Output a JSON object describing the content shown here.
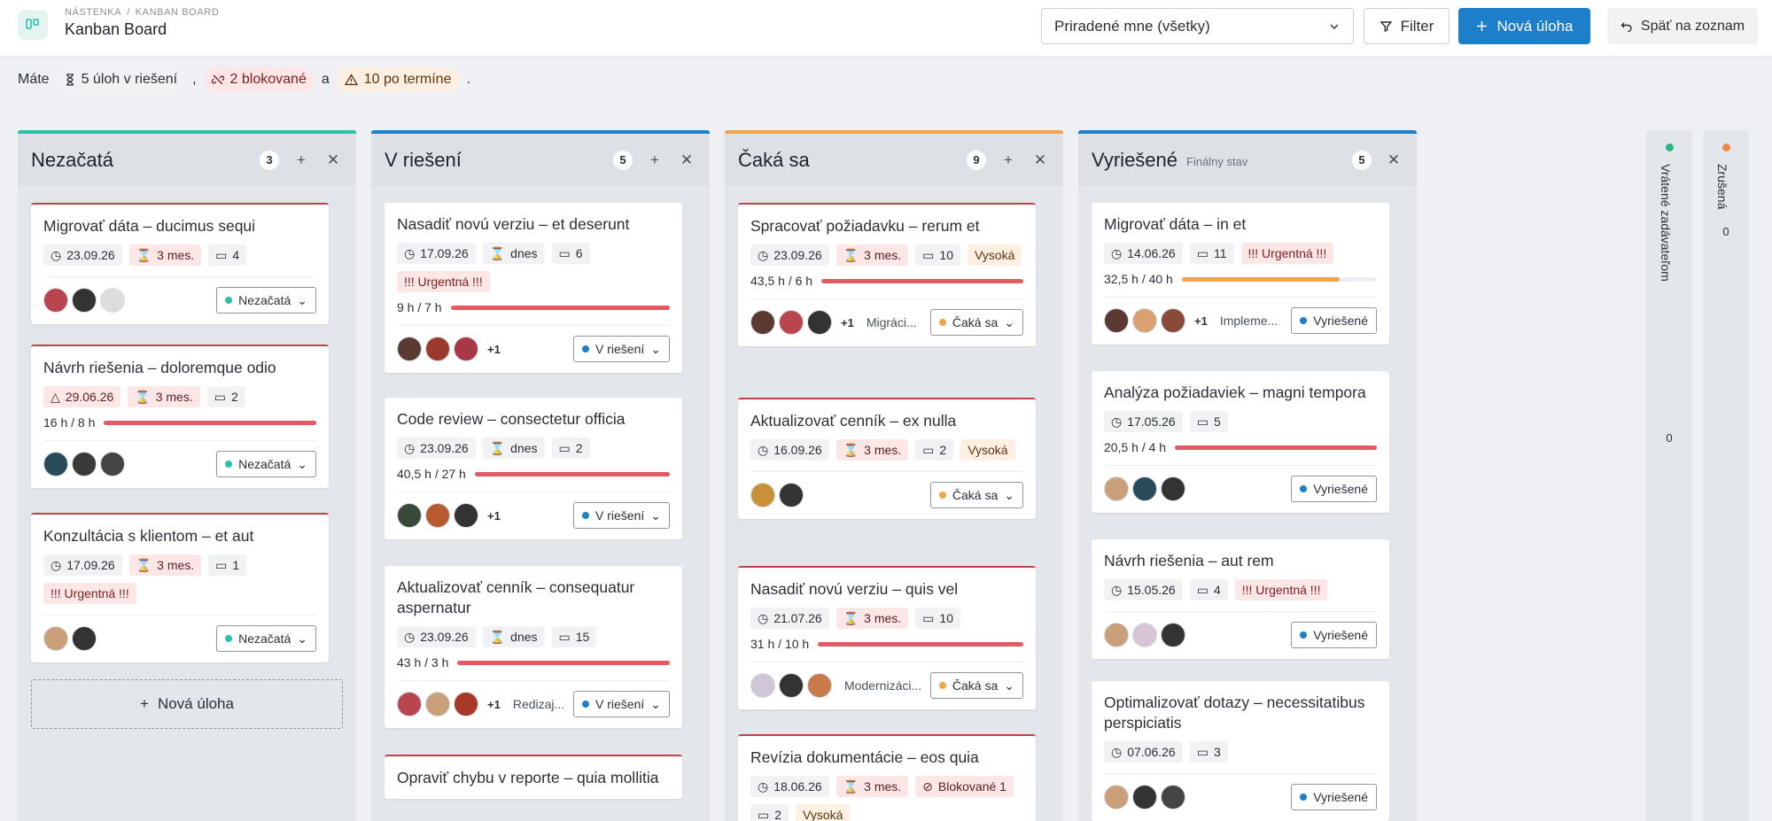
{
  "header": {
    "breadcrumb": [
      "NÁSTENKA",
      "KANBAN BOARD"
    ],
    "title": "Kanban Board",
    "assign_select": "Priradené mne (všetky)",
    "filter_label": "Filter",
    "new_task_label": "Nová úloha",
    "back_label": "Späť na zoznam"
  },
  "summary": {
    "prefix": "Máte",
    "in_progress": "5 úloh v riešení",
    "comma": ",",
    "blocked": "2 blokované",
    "and": "a",
    "overdue": "10 po termíne",
    "end": "."
  },
  "colors": {
    "teal": "#2bbfae",
    "blue": "#1d7ec9",
    "orange": "#f0a54a",
    "red_bar": "#e35a64",
    "green": "#2cb67d",
    "coral": "#f0844a"
  },
  "columns": [
    {
      "title": "Nezačatá",
      "subtitle": "",
      "count": "3",
      "cards": [
        {
          "title": "Migrovať dáta – ducimus sequi",
          "date": "23.09.26",
          "duration": "3 mes.",
          "comments": "4",
          "status": "Nezačatá"
        },
        {
          "title": "Návrh riešenia – doloremque odio",
          "date": "29.06.26",
          "duration": "3 mes.",
          "comments": "2",
          "progress_text": "16 h / 8 h",
          "progress": 1.0,
          "status": "Nezačatá"
        },
        {
          "title": "Konzultácia s klientom – et aut",
          "date": "17.09.26",
          "duration": "3 mes.",
          "comments": "1",
          "priority": "!!! Urgentná !!!",
          "status": "Nezačatá"
        }
      ],
      "new_task_label": "Nová úloha"
    },
    {
      "title": "V riešení",
      "subtitle": "",
      "count": "5",
      "cards": [
        {
          "title": "Nasadiť novú verziu – et deserunt",
          "date": "17.09.26",
          "duration": "dnes",
          "comments": "6",
          "priority": "!!! Urgentná !!!",
          "progress_text": "9 h / 7 h",
          "progress": 1.0,
          "more": "+1",
          "status": "V riešení"
        },
        {
          "title": "Code review – consectetur officia",
          "date": "23.09.26",
          "duration": "dnes",
          "comments": "2",
          "progress_text": "40,5 h / 27 h",
          "progress": 1.0,
          "more": "+1",
          "status": "V riešení"
        },
        {
          "title": "Aktualizovať cenník – consequatur aspernatur",
          "date": "23.09.26",
          "duration": "dnes",
          "comments": "15",
          "progress_text": "43 h / 3 h",
          "progress": 1.0,
          "more": "+1",
          "project": "Redizaj...",
          "status": "V riešení"
        },
        {
          "title": "Opraviť chybu v reporte – quia mollitia"
        }
      ]
    },
    {
      "title": "Čaká sa",
      "subtitle": "",
      "count": "9",
      "cards": [
        {
          "title": "Spracovať požiadavku – rerum et",
          "date": "23.09.26",
          "duration": "3 mes.",
          "comments": "10",
          "priority": "Vysoká",
          "progress_text": "43,5 h / 6 h",
          "progress": 1.0,
          "more": "+1",
          "project": "Migráci...",
          "status": "Čaká sa"
        },
        {
          "title": "Aktualizovať cenník – ex nulla",
          "date": "16.09.26",
          "duration": "3 mes.",
          "comments": "2",
          "priority": "Vysoká",
          "status": "Čaká sa"
        },
        {
          "title": "Nasadiť novú verziu – quis vel",
          "date": "21.07.26",
          "duration": "3 mes.",
          "comments": "10",
          "progress_text": "31 h / 10 h",
          "progress": 1.0,
          "project": "Modernizáci...",
          "status": "Čaká sa"
        },
        {
          "title": "Revízia dokumentácie – eos quia",
          "date": "18.06.26",
          "duration": "3 mes.",
          "blocked": "Blokované 1",
          "comments": "2",
          "priority": "Vysoká"
        }
      ]
    },
    {
      "title": "Vyriešené",
      "subtitle": "Finálny stav",
      "count": "5",
      "cards": [
        {
          "title": "Migrovať dáta – in et",
          "date": "14.06.26",
          "comments": "11",
          "priority": "!!! Urgentná !!!",
          "progress_text": "32,5 h / 40 h",
          "progress": 0.81,
          "more": "+1",
          "project": "Impleme...",
          "status": "Vyriešené"
        },
        {
          "title": "Analýza požiadaviek – magni tempora",
          "date": "17.05.26",
          "comments": "5",
          "progress_text": "20,5 h / 4 h",
          "progress": 1.0,
          "status": "Vyriešené"
        },
        {
          "title": "Návrh riešenia – aut rem",
          "date": "15.05.26",
          "comments": "4",
          "priority": "!!! Urgentná !!!",
          "status": "Vyriešené"
        },
        {
          "title": "Optimalizovať dotazy – necessitatibus perspiciatis",
          "date": "07.06.26",
          "comments": "3",
          "status": "Vyriešené"
        }
      ]
    }
  ],
  "side_columns": [
    {
      "title": "Vrátené zadávateľom",
      "count": "0"
    },
    {
      "title": "Zrušená",
      "count": "0"
    }
  ]
}
